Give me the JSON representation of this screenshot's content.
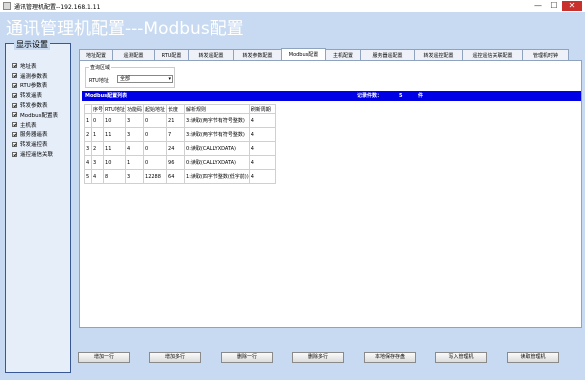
{
  "window": {
    "title": "通讯管理机配置--192.168.1.11",
    "minimize": "—",
    "maximize": "☐",
    "close": "✕"
  },
  "heading": "通讯管理机配置---Modbus配置",
  "sidebar": {
    "legend": "显示设置",
    "items": [
      {
        "label": "地址表",
        "checked": true
      },
      {
        "label": "遥测参数表",
        "checked": true
      },
      {
        "label": "RTU参数表",
        "checked": true
      },
      {
        "label": "转发遥表",
        "checked": true
      },
      {
        "label": "转发参数表",
        "checked": true
      },
      {
        "label": "Modbus配置表",
        "checked": true
      },
      {
        "label": "主机表",
        "checked": true
      },
      {
        "label": "服务器遥表",
        "checked": true
      },
      {
        "label": "转发遥控表",
        "checked": true
      },
      {
        "label": "遥控遥信关联",
        "checked": true
      }
    ]
  },
  "tabs": [
    {
      "label": "地址配置",
      "active": false
    },
    {
      "label": "遥测配置",
      "active": false
    },
    {
      "label": "RTU配置",
      "active": false
    },
    {
      "label": "转发遥配置",
      "active": false
    },
    {
      "label": "转发参数配置",
      "active": false
    },
    {
      "label": "Modbus配置",
      "active": true
    },
    {
      "label": "主机配置",
      "active": false
    },
    {
      "label": "服务器遥配置",
      "active": false
    },
    {
      "label": "转发遥控配置",
      "active": false
    },
    {
      "label": "遥控遥信关联配置",
      "active": false
    },
    {
      "label": "管理机时钟",
      "active": false
    }
  ],
  "query": {
    "legend": "查询区域",
    "rtu_label": "RTU地址",
    "rtu_value": "全部"
  },
  "list_bar": {
    "title": "Modbus配置列表",
    "count_label": "记录件数：",
    "count": "5",
    "unit": "件"
  },
  "table": {
    "headers": [
      "",
      "序号",
      "RTU地址",
      "功能码",
      "起始地址",
      "长度",
      "解析规则",
      "刷新周期"
    ],
    "rows": [
      [
        "1",
        "0",
        "10",
        "3",
        "0",
        "21",
        "3:读取(两字节有符号整数)",
        "4"
      ],
      [
        "2",
        "1",
        "11",
        "3",
        "0",
        "7",
        "3:读取(两字节有符号整数)",
        "4"
      ],
      [
        "3",
        "2",
        "11",
        "4",
        "0",
        "24",
        "0:读取(CALLYXDATA)",
        "4"
      ],
      [
        "4",
        "3",
        "10",
        "1",
        "0",
        "96",
        "0:读取(CALLYXDATA)",
        "4"
      ],
      [
        "5",
        "4",
        "8",
        "3",
        "12288",
        "64",
        "1:读取(四字节整数(低字前))",
        "4"
      ]
    ]
  },
  "buttons": {
    "add_one": "增加一行",
    "add_many": "增加多行",
    "delete_one": "删除一行",
    "delete_many": "删除多行",
    "save_local": "本地保存存盘",
    "write": "写入管理机",
    "read": "读取管理机"
  }
}
